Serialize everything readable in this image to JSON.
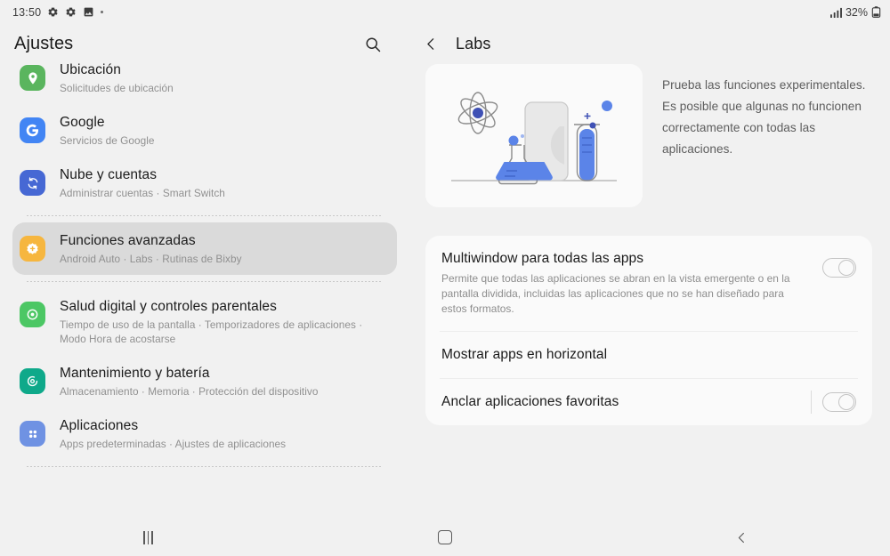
{
  "statusbar": {
    "time": "13:50",
    "icons": [
      "gear-icon",
      "gear-icon",
      "image-icon",
      "dot-icon"
    ],
    "signal": "signal-bars-icon",
    "battery_percent": "32%",
    "battery_icon": "battery-icon"
  },
  "sidebar": {
    "title": "Ajustes",
    "search_icon": "search-icon",
    "items": [
      {
        "name": "ubicacion",
        "label": "Ubicación",
        "sub": "Solicitudes de ubicación",
        "icon": "location-pin-icon",
        "color": "#5ab55e",
        "selected": false,
        "clipped": true
      },
      {
        "name": "google",
        "label": "Google",
        "sub": "Servicios de Google",
        "icon": "google-g-icon",
        "color": "#4285f4",
        "selected": false,
        "clipped": false
      },
      {
        "name": "nube-y-cuentas",
        "label": "Nube y cuentas",
        "sub": "Administrar cuentas  ·  Smart Switch",
        "icon": "cloud-sync-icon",
        "color": "#4668d4",
        "selected": false,
        "clipped": false
      },
      {
        "name": "funciones-avanzadas",
        "label": "Funciones avanzadas",
        "sub": "Android Auto  ·  Labs  ·  Rutinas de Bixby",
        "icon": "advanced-features-icon",
        "color": "#f6b63f",
        "selected": true,
        "clipped": false
      },
      {
        "name": "salud-digital",
        "label": "Salud digital y controles parentales",
        "sub": "Tiempo de uso de la pantalla  ·  Temporizadores de aplicaciones  ·  Modo Hora de acostarse",
        "icon": "digital-wellbeing-icon",
        "color": "#4cc764",
        "selected": false,
        "clipped": false
      },
      {
        "name": "mantenimiento-y-bateria",
        "label": "Mantenimiento y batería",
        "sub": "Almacenamiento  ·  Memoria  ·  Protección del dispositivo",
        "icon": "device-care-icon",
        "color": "#0fa98a",
        "selected": false,
        "clipped": false
      },
      {
        "name": "aplicaciones",
        "label": "Aplicaciones",
        "sub": "Apps predeterminadas  ·  Ajustes de aplicaciones",
        "icon": "apps-grid-icon",
        "color": "#6f92e3",
        "selected": false,
        "clipped": false
      }
    ]
  },
  "detail": {
    "back_icon": "chevron-left-icon",
    "title": "Labs",
    "hero": {
      "illustration": "labs-science-illustration",
      "description": "Prueba las funciones experimentales. Es posible que algunas no funcionen correctamente con todas las aplicaciones."
    },
    "preferences": [
      {
        "name": "multiwindow-para-todas-las-apps",
        "title": "Multiwindow para todas las apps",
        "description": "Permite que todas las aplicaciones se abran en la vista emergente o en la pantalla dividida, incluidas las aplicaciones que no se han diseñado para estos formatos.",
        "has_toggle": true,
        "toggle_on": false,
        "has_divider_before_toggle": false
      },
      {
        "name": "mostrar-apps-en-horizontal",
        "title": "Mostrar apps en horizontal",
        "description": "",
        "has_toggle": false,
        "toggle_on": false,
        "has_divider_before_toggle": false
      },
      {
        "name": "anclar-aplicaciones-favoritas",
        "title": "Anclar aplicaciones favoritas",
        "description": "",
        "has_toggle": true,
        "toggle_on": false,
        "has_divider_before_toggle": true
      }
    ]
  },
  "navbar": {
    "recents_label": "recents-icon",
    "home_label": "home-icon",
    "back_label": "back-icon"
  },
  "colors": {
    "page_bg": "#f1f1f1",
    "card_bg": "#fafafa",
    "selected_bg": "#dadada",
    "title_text": "#1b1b1b",
    "sub_text": "#909090"
  }
}
